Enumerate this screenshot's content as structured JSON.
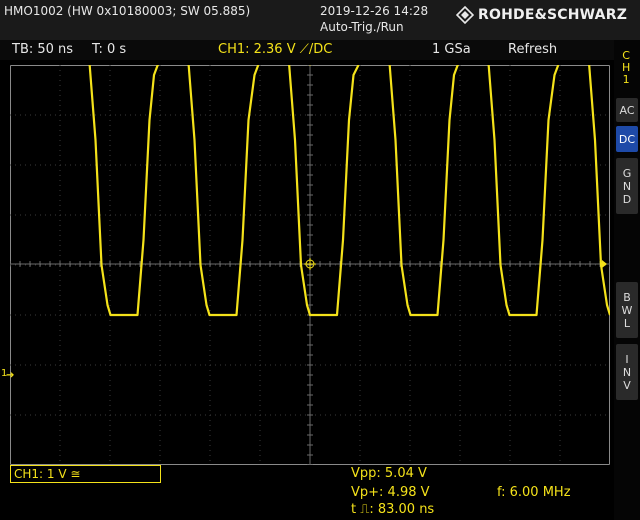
{
  "device": {
    "id_string": "HMO1002 (HW 0x10180003; SW 05.885)",
    "datetime": "2019-12-26 14:28",
    "trigger_status": "Auto-Trig./Run",
    "brand": "ROHDE&SCHWARZ"
  },
  "infobar": {
    "timebase": "TB: 50 ns",
    "trigger_time": "T: 0 s",
    "trigger_info": "CH1: 2.36 V ⟋/DC",
    "sample_rate": "1 GSa",
    "mode": "Refresh"
  },
  "side_panel": {
    "channel_label": [
      "C",
      "H",
      "1"
    ],
    "buttons": [
      {
        "label": "AC",
        "active": false
      },
      {
        "label": "DC",
        "active": true
      },
      {
        "label": "GND",
        "active": false
      },
      {
        "label": "BWL",
        "active": false
      },
      {
        "label": "INV",
        "active": false
      }
    ]
  },
  "channel_marker": "1",
  "channel_setting": "CH1: 1 V ≅",
  "measurements": {
    "vpp": "Vpp: 5.04 V",
    "vp_plus": "Vp+: 4.98 V",
    "pulse_width": "t ⎍: 83.00 ns",
    "frequency": "f: 6.00 MHz"
  },
  "colors": {
    "trace": "#f4e21a",
    "grid": "#555555",
    "background": "#000000",
    "active_button": "#1e4aa8"
  },
  "chart_data": {
    "type": "line",
    "series": [
      {
        "x_ns": [
          0,
          20,
          24,
          28,
          32,
          34,
          40,
          52,
          56,
          60,
          63,
          66,
          73,
          86,
          90,
          94,
          98,
          100,
          107,
          118,
          122,
          126,
          130,
          133,
          140,
          153,
          157,
          161,
          165,
          167,
          173,
          185,
          189,
          193,
          196,
          200
        ],
        "y_v": [
          5.04,
          5.04,
          3.5,
          1.0,
          0.2,
          0.0,
          0.0,
          0.0,
          1.5,
          3.9,
          4.8,
          5.04,
          5.04,
          5.04,
          3.5,
          1.0,
          0.2,
          0.0,
          0.0,
          0.0,
          1.5,
          3.9,
          4.8,
          5.04,
          5.04,
          5.04,
          3.5,
          1.0,
          0.2,
          0.0,
          0.0,
          0.0,
          1.5,
          3.9,
          4.8,
          5.04
        ]
      }
    ],
    "xlim_ns": [
      -200,
      200
    ],
    "ylim_v": [
      -3,
      5
    ],
    "grid": true
  }
}
